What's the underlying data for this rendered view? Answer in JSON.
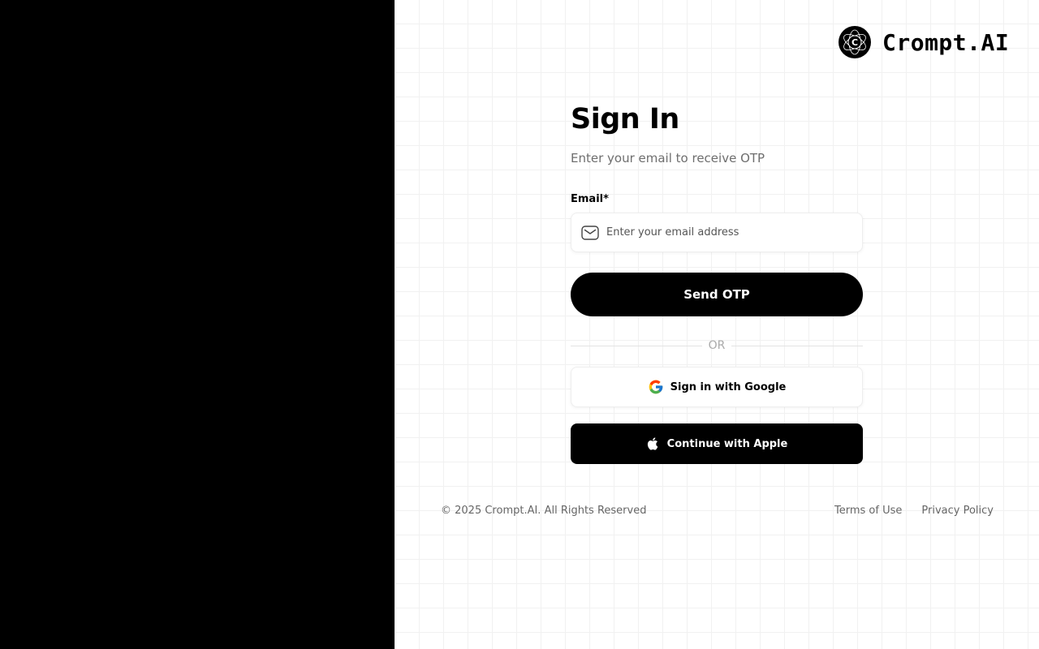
{
  "brand": {
    "name": "Crompt.AI",
    "logo_letter": "C"
  },
  "signin": {
    "title": "Sign In",
    "subtitle": "Enter your email to receive OTP",
    "email_label": "Email*",
    "email_placeholder": "Enter your email address",
    "email_value": "",
    "email_icon": "mail-icon",
    "send_button": "Send OTP",
    "divider_text": "OR",
    "google_button": "Sign in with Google",
    "google_icon": "google-icon",
    "apple_button": "Continue with Apple",
    "apple_icon": "apple-icon"
  },
  "footer": {
    "copyright": "© 2025 Crompt.AI. All Rights Reserved",
    "terms": "Terms of Use",
    "privacy": "Privacy Policy"
  },
  "colors": {
    "left_panel": "#000000",
    "primary": "#000000",
    "background": "#ffffff",
    "muted_text": "#6e6e6e"
  }
}
